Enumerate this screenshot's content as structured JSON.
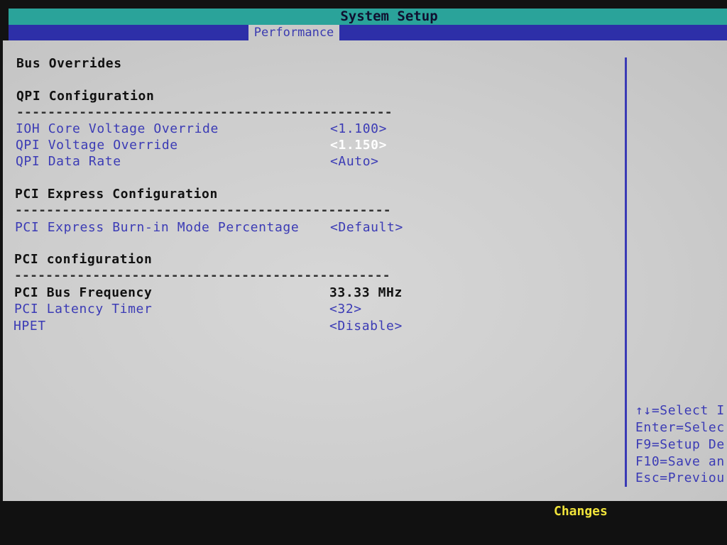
{
  "title": "System Setup",
  "tab": "Performance",
  "section_title": "Bus Overrides",
  "groups": [
    {
      "heading": "QPI Configuration",
      "separator": "------------------------------------------------",
      "items": [
        {
          "label": "IOH Core Voltage Override",
          "value": "<1.100>"
        },
        {
          "label": "QPI Voltage Override",
          "value": "<1.150>",
          "selected": true
        },
        {
          "label": "QPI Data Rate",
          "value": "<Auto>"
        }
      ]
    },
    {
      "heading": "PCI Express Configuration",
      "separator": "------------------------------------------------",
      "items": [
        {
          "label": "PCI Express Burn-in Mode Percentage",
          "value": "<Default>"
        }
      ]
    },
    {
      "heading": "PCI configuration",
      "separator": "------------------------------------------------",
      "items": [
        {
          "label": "PCI Bus Frequency",
          "value": "33.33 MHz",
          "static": true
        },
        {
          "label": "PCI Latency Timer",
          "value": "<32>"
        },
        {
          "label": "HPET",
          "value": "<Disable>"
        }
      ]
    }
  ],
  "help": [
    "↑↓=Select I",
    "Enter=Selec",
    "F9=Setup De",
    "F10=Save an",
    "Esc=Previou"
  ],
  "footer": "Changes",
  "colors": {
    "title_bar": "#2aa39a",
    "tab_bar": "#2d2fa8",
    "option_text": "#3b3bb5",
    "selected_value": "#ffffff",
    "footer_text": "#f0e33a"
  }
}
